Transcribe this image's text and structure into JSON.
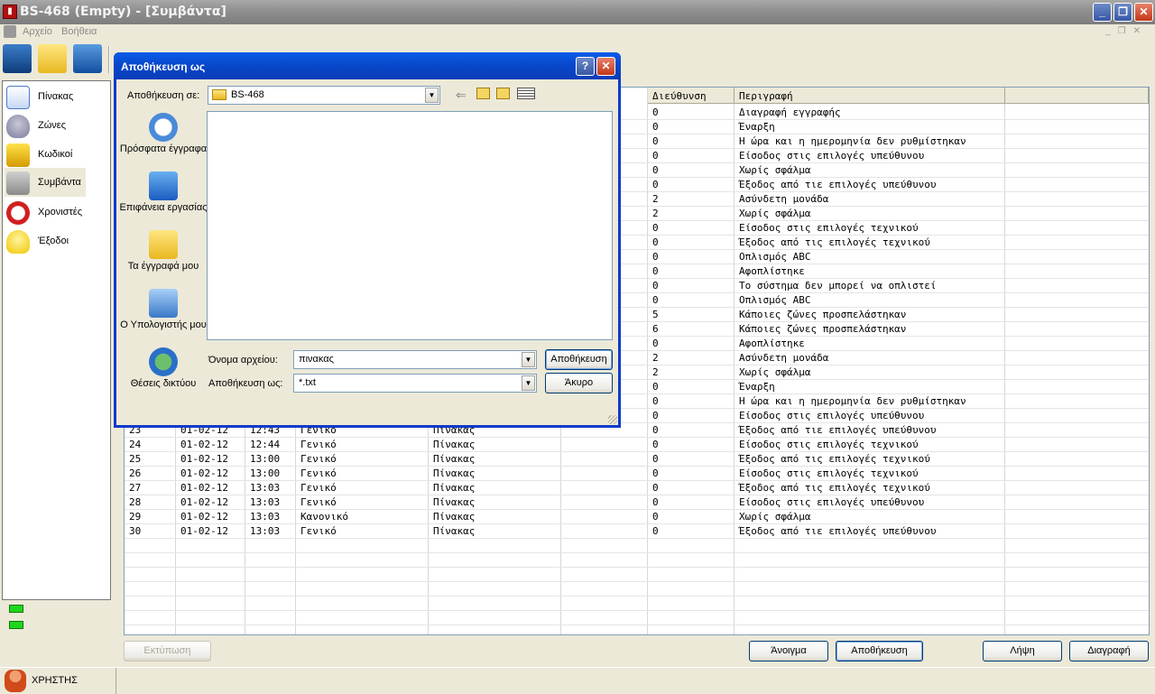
{
  "window": {
    "title": "BS-468 (Empty) - [Συμβάντα]",
    "app_icon_glyph": "▮"
  },
  "menu": {
    "items": [
      "Αρχείο",
      "Βοήθεια"
    ]
  },
  "toolbar": {
    "icons": [
      "computer-icon",
      "folder-icon",
      "save-disk-icon"
    ]
  },
  "sidebar": {
    "items": [
      {
        "label": "Πίνακας",
        "icon": "panel-icon"
      },
      {
        "label": "Ζώνες",
        "icon": "zones-bell-icon"
      },
      {
        "label": "Κωδικοί",
        "icon": "padlock-icon"
      },
      {
        "label": "Συμβάντα",
        "icon": "events-icon",
        "selected": true
      },
      {
        "label": "Χρονιστές",
        "icon": "alarm-clock-icon"
      },
      {
        "label": "Έξοδοι",
        "icon": "lightbulb-icon"
      }
    ]
  },
  "user": {
    "label": "ΧΡΗΣΤΗΣ"
  },
  "table": {
    "headers": {
      "address": "Διεύθυνση",
      "description": "Περιγραφή"
    },
    "upper_rows": [
      {
        "address": "0",
        "description": "Διαγραφή εγγραφής"
      },
      {
        "address": "0",
        "description": "Έναρξη"
      },
      {
        "address": "0",
        "description": "Η ώρα και η ημερομηνία δεν ρυθμίστηκαν"
      },
      {
        "address": "0",
        "description": "Είσοδος στις επιλογές υπεύθυνου"
      },
      {
        "address": "0",
        "description": "Χωρίς σφάλμα"
      },
      {
        "address": "0",
        "description": "Έξοδος από τιε επιλογές υπεύθυνου"
      },
      {
        "address": "2",
        "description": "Ασύνδετη μονάδα"
      },
      {
        "address": "2",
        "description": "Χωρίς σφάλμα"
      },
      {
        "address": "0",
        "description": "Είσοδος στις επιλογές τεχνικού"
      },
      {
        "address": "0",
        "description": "Έξοδος από τις επιλογές τεχνικού"
      },
      {
        "address": "0",
        "description": "Οπλισμός ABC"
      },
      {
        "address": "0",
        "description": "Αφοπλίστηκε"
      },
      {
        "address": "0",
        "description": "Το σύστημα δεν μπορεί να οπλιστεί"
      },
      {
        "address": "0",
        "description": "Οπλισμός ABC"
      },
      {
        "address": "5",
        "description": "Κάποιες ζώνες προσπελάστηκαν"
      },
      {
        "address": "6",
        "description": "Κάποιες ζώνες προσπελάστηκαν"
      },
      {
        "address": "0",
        "description": "Αφοπλίστηκε"
      },
      {
        "address": "2",
        "description": "Ασύνδετη μονάδα"
      },
      {
        "address": "2",
        "description": "Χωρίς σφάλμα"
      },
      {
        "address": "0",
        "description": "Έναρξη"
      },
      {
        "address": "0",
        "description": "Η ώρα και η ημερομηνία δεν ρυθμίστηκαν"
      },
      {
        "address": "0",
        "description": "Είσοδος στις επιλογές υπεύθυνου"
      }
    ],
    "lower_rows": [
      {
        "no": "23",
        "date": "01-02-12",
        "time": "12:43",
        "type": "Γενικό",
        "source": "Πίνακας",
        "address": "0",
        "description": "Έξοδος από τιε επιλογές υπεύθυνου"
      },
      {
        "no": "24",
        "date": "01-02-12",
        "time": "12:44",
        "type": "Γενικό",
        "source": "Πίνακας",
        "address": "0",
        "description": "Είσοδος στις επιλογές τεχνικού"
      },
      {
        "no": "25",
        "date": "01-02-12",
        "time": "13:00",
        "type": "Γενικό",
        "source": "Πίνακας",
        "address": "0",
        "description": "Έξοδος από τις επιλογές τεχνικού"
      },
      {
        "no": "26",
        "date": "01-02-12",
        "time": "13:00",
        "type": "Γενικό",
        "source": "Πίνακας",
        "address": "0",
        "description": "Είσοδος στις επιλογές τεχνικού"
      },
      {
        "no": "27",
        "date": "01-02-12",
        "time": "13:03",
        "type": "Γενικό",
        "source": "Πίνακας",
        "address": "0",
        "description": "Έξοδος από τις επιλογές τεχνικού"
      },
      {
        "no": "28",
        "date": "01-02-12",
        "time": "13:03",
        "type": "Γενικό",
        "source": "Πίνακας",
        "address": "0",
        "description": "Είσοδος στις επιλογές υπεύθυνου"
      },
      {
        "no": "29",
        "date": "01-02-12",
        "time": "13:03",
        "type": "Κανονικό",
        "source": "Πίνακας",
        "address": "0",
        "description": "Χωρίς σφάλμα"
      },
      {
        "no": "30",
        "date": "01-02-12",
        "time": "13:03",
        "type": "Γενικό",
        "source": "Πίνακας",
        "address": "0",
        "description": "Έξοδος από τιε επιλογές υπεύθυνου"
      }
    ]
  },
  "buttons": {
    "print": "Εκτύπωση",
    "open": "Άνοιγμα",
    "save": "Αποθήκευση",
    "receive": "Λήψη",
    "delete": "Διαγραφή"
  },
  "dialog": {
    "title": "Αποθήκευση ως",
    "help_glyph": "?",
    "close_glyph": "✕",
    "save_in_label": "Αποθήκευση σε:",
    "save_in_value": "BS-468",
    "places": [
      "Πρόσφατα έγγραφα",
      "Επιφάνεια εργασίας",
      "Τα έγγραφά μου",
      "Ο Υπολογιστής μου",
      "Θέσεις δικτύου"
    ],
    "filename_label": "Όνομα αρχείου:",
    "filename_value": "πινακας",
    "filetype_label": "Αποθήκευση ως:",
    "filetype_value": "*.txt",
    "save_button": "Αποθήκευση",
    "cancel_button": "Άκυρο"
  }
}
